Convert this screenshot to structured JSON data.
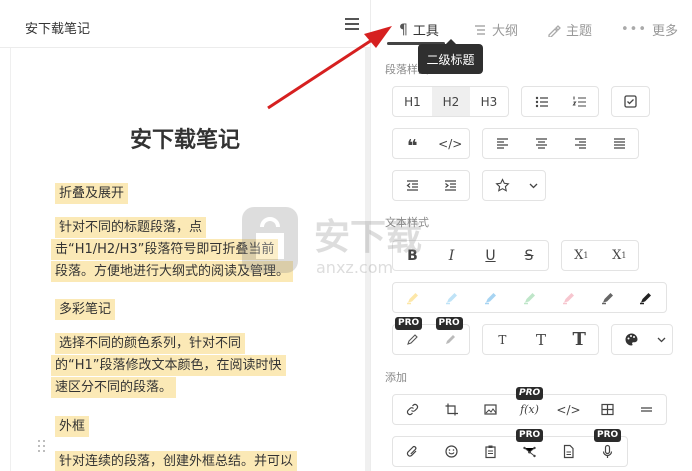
{
  "editor": {
    "doc_title": "安下载笔记",
    "page_title": "安下载笔记",
    "blocks": [
      {
        "lines": [
          "折叠及展开"
        ]
      },
      {
        "lines": [
          "针对不同的标题段落，点",
          "击“H1/H2/H3”段落符号即可折叠当前",
          "段落。方便地进行大纲式的阅读及管理。"
        ]
      },
      {
        "lines": [
          "多彩笔记"
        ]
      },
      {
        "lines": [
          "选择不同的颜色系列，针对不同",
          "的“H1”段落修改文本颜色，在阅读时快",
          "速区分不同的段落。"
        ]
      },
      {
        "lines": [
          "外框"
        ]
      },
      {
        "lines": [
          "针对连续的段落，创建外框总结。并可以"
        ]
      }
    ]
  },
  "tabs": [
    {
      "label": "工具",
      "icon": "pilcrow-icon"
    },
    {
      "label": "大纲",
      "icon": "outline-icon"
    },
    {
      "label": "主题",
      "icon": "theme-brush-icon"
    },
    {
      "label": "更多",
      "icon": "more-dots-icon"
    }
  ],
  "tooltip": "二级标题",
  "sections": {
    "paragraph": "段落样式",
    "text": "文本样式",
    "insert": "添加"
  },
  "headings": [
    "H1",
    "H2",
    "H3"
  ],
  "text_style": {
    "bold": "B",
    "italic": "I",
    "underline": "U",
    "strike": "S",
    "subscript_base": "X",
    "subscript_mark": "1",
    "superscript_base": "X",
    "superscript_mark": "1"
  },
  "font_sizes": [
    "T",
    "T",
    "T"
  ],
  "highlighters": [
    "#fde7a8",
    "#bfe3f7",
    "#a7d4f2",
    "#bfe6c9",
    "#f7c6cf",
    "#666666",
    "#222222"
  ],
  "pro_badge": "PRO",
  "watermark": {
    "text": "安下载",
    "sub": "anxz.com"
  },
  "colors": {
    "highlight": "#fbe9b6",
    "arrow": "#d62020",
    "tooltip_bg": "#2f2f2f"
  }
}
